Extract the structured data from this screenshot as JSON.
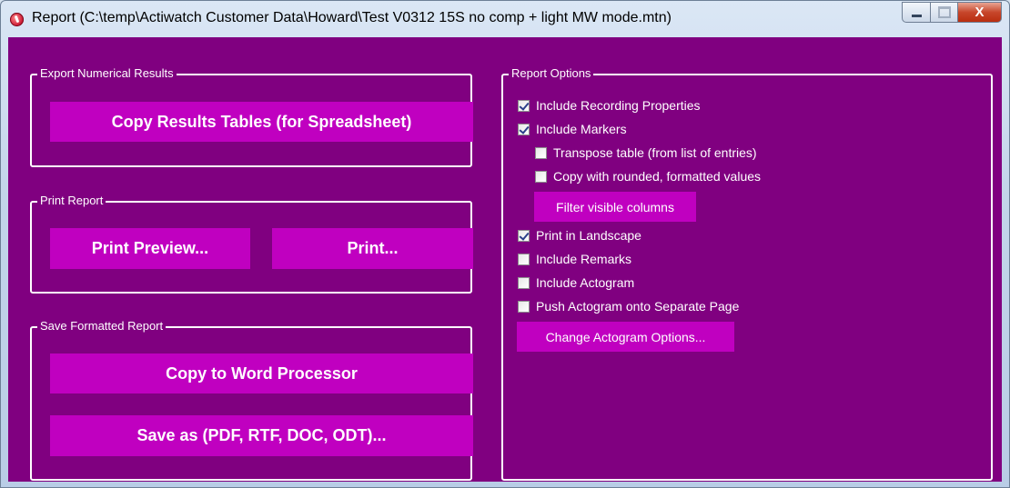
{
  "window": {
    "title": "Report (C:\\temp\\Actiwatch Customer Data\\Howard\\Test V0312 15S no comp + light MW mode.mtn)",
    "close_glyph": "X"
  },
  "export": {
    "legend": "Export Numerical Results",
    "copy_results_label": "Copy Results Tables (for Spreadsheet)"
  },
  "print": {
    "legend": "Print Report",
    "preview_label": "Print Preview...",
    "print_label": "Print..."
  },
  "save": {
    "legend": "Save Formatted Report",
    "copy_word_label": "Copy to Word Processor",
    "save_as_label": "Save as (PDF, RTF, DOC, ODT)..."
  },
  "options": {
    "legend": "Report Options",
    "items": [
      {
        "label": "Include Recording Properties",
        "checked": true
      },
      {
        "label": "Include Markers",
        "checked": true
      },
      {
        "label": "Transpose table (from list of entries)",
        "checked": false
      },
      {
        "label": "Copy with rounded, formatted values",
        "checked": false
      },
      {
        "label": "Print in Landscape",
        "checked": true
      },
      {
        "label": "Include Remarks",
        "checked": false
      },
      {
        "label": "Include Actogram",
        "checked": false
      },
      {
        "label": "Push Actogram onto Separate Page",
        "checked": false
      }
    ],
    "filter_columns_label": "Filter visible columns",
    "change_actogram_label": "Change Actogram Options..."
  },
  "colors": {
    "background": "#800080",
    "button": "#c000c0",
    "text": "#ffffff"
  }
}
